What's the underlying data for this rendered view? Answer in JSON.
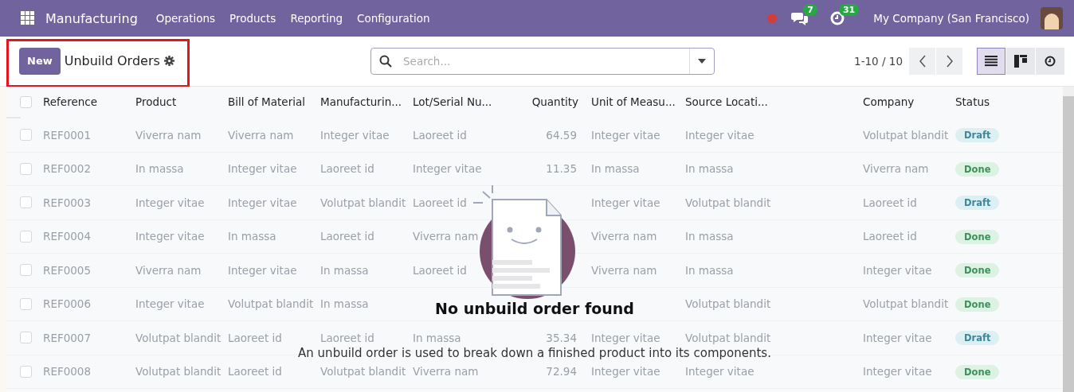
{
  "navbar": {
    "app_name": "Manufacturing",
    "menu": [
      "Operations",
      "Products",
      "Reporting",
      "Configuration"
    ],
    "chat_count": "7",
    "activity_count": "31",
    "company": "My Company (San Francisco)"
  },
  "control_panel": {
    "new_button": "New",
    "title": "Unbuild Orders",
    "search": {
      "placeholder": "Search..."
    },
    "pager": "1-10 / 10",
    "views": [
      {
        "kind": "list",
        "selected": true
      },
      {
        "kind": "kanban",
        "selected": false
      },
      {
        "kind": "activity",
        "selected": false
      }
    ]
  },
  "table": {
    "select_all_checked": false,
    "columns": [
      "Reference",
      "Product",
      "Bill of Material",
      "Manufacturin...",
      "Lot/Serial Nu...",
      "Quantity",
      "Unit of Measu...",
      "Source Locati...",
      "Company",
      "Status"
    ],
    "rows": [
      {
        "checked": false,
        "cells": [
          "REF0001",
          "Viverra nam",
          "Viverra nam",
          "Integer vitae",
          "Laoreet id",
          "64.59",
          "Integer vitae",
          "Integer vitae",
          "Volutpat blandit"
        ],
        "status": {
          "label": "Draft",
          "kind": "draft"
        }
      },
      {
        "checked": false,
        "cells": [
          "REF0002",
          "In massa",
          "Integer vitae",
          "Laoreet id",
          "Integer vitae",
          "11.35",
          "In massa",
          "In massa",
          "Viverra nam"
        ],
        "status": {
          "label": "Done",
          "kind": "done"
        }
      },
      {
        "checked": false,
        "cells": [
          "REF0003",
          "Integer vitae",
          "Integer vitae",
          "Volutpat blandit",
          "Laoreet id",
          null,
          "Integer vitae",
          "Volutpat blandit",
          "Laoreet id"
        ],
        "status": {
          "label": "Draft",
          "kind": "draft"
        }
      },
      {
        "checked": false,
        "cells": [
          "REF0004",
          "Integer vitae",
          "In massa",
          "Laoreet id",
          "Viverra nam",
          null,
          "Viverra nam",
          "In massa",
          "Laoreet id"
        ],
        "status": {
          "label": "Done",
          "kind": "done"
        }
      },
      {
        "checked": false,
        "cells": [
          "REF0005",
          "Viverra nam",
          "Integer vitae",
          "In massa",
          "Laoreet id",
          null,
          "Viverra nam",
          "In massa",
          "Integer vitae"
        ],
        "status": {
          "label": "Done",
          "kind": "done"
        }
      },
      {
        "checked": false,
        "cells": [
          "REF0006",
          "Integer vitae",
          "Volutpat blandit",
          "In massa",
          null,
          null,
          null,
          "Volutpat blandit",
          "Volutpat blandit"
        ],
        "status": {
          "label": "Done",
          "kind": "done"
        }
      },
      {
        "checked": false,
        "cells": [
          "REF0007",
          "Volutpat blandit",
          "Laoreet id",
          "Laoreet id",
          "In massa",
          "35.34",
          "Integer vitae",
          "Volutpat blandit",
          "Integer vitae"
        ],
        "status": {
          "label": "Draft",
          "kind": "draft"
        }
      },
      {
        "checked": false,
        "cells": [
          "REF0008",
          "Volutpat blandit",
          "Laoreet id",
          "Volutpat blandit",
          "Viverra nam",
          "72.94",
          "Integer vitae",
          "Integer vitae",
          "Integer vitae"
        ],
        "status": {
          "label": "Done",
          "kind": "done"
        }
      }
    ]
  },
  "empty_state": {
    "title": "No unbuild order found",
    "text": "An unbuild order is used to break down a finished product into its components."
  }
}
